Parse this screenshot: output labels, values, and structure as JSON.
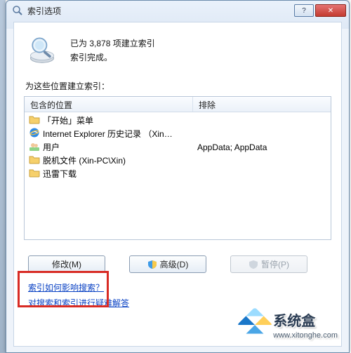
{
  "window": {
    "title": "索引选项",
    "buttons": {
      "help": "?",
      "close": "✕"
    }
  },
  "summary": {
    "line1_prefix": "已为 ",
    "count": "3,878",
    "line1_suffix": " 项建立索引",
    "line2": "索引完成。"
  },
  "section_label": "为这些位置建立索引：",
  "listview": {
    "headers": {
      "col1": "包含的位置",
      "col2": "排除"
    },
    "rows": [
      {
        "icon": "folder",
        "name": "「开始」菜单",
        "exclude": ""
      },
      {
        "icon": "ie",
        "name": "Internet Explorer 历史记录 （Xin…",
        "exclude": ""
      },
      {
        "icon": "user",
        "name": "用户",
        "exclude": "AppData; AppData"
      },
      {
        "icon": "folder",
        "name": "脱机文件 (Xin-PC\\Xin)",
        "exclude": ""
      },
      {
        "icon": "folder",
        "name": "迅雷下载",
        "exclude": ""
      }
    ]
  },
  "buttons": {
    "modify": "修改(M)",
    "advanced": "高级(D)",
    "pause": "暂停(P)"
  },
  "links": {
    "link1": "索引如何影响搜索？",
    "link2": "对搜索和索引进行疑难解答"
  },
  "watermark": {
    "name": "系统盒",
    "url": "www.xitonghe.com"
  }
}
